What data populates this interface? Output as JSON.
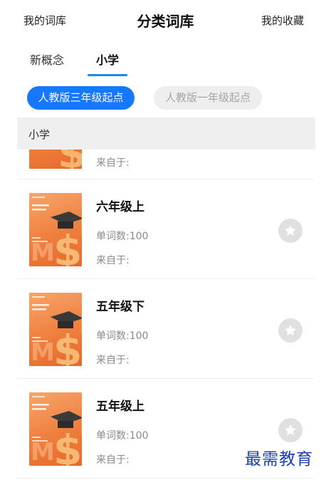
{
  "header": {
    "left_label": "我的词库",
    "title": "分类词库",
    "right_label": "我的收藏"
  },
  "tabs": [
    {
      "label": "新概念",
      "active": false
    },
    {
      "label": "小学",
      "active": true
    }
  ],
  "chips": [
    {
      "label": "人教版三年级起点",
      "active": true
    },
    {
      "label": "人教版一年级起点",
      "active": false
    }
  ],
  "section": {
    "label": "小学"
  },
  "partial_item": {
    "from_label": "来自于:"
  },
  "items": [
    {
      "name": "六年级上",
      "count_label": "单词数:100",
      "from_label": "来自于:",
      "favorited": false
    },
    {
      "name": "五年级下",
      "count_label": "单词数:100",
      "from_label": "来自于:",
      "favorited": false
    },
    {
      "name": "五年级上",
      "count_label": "单词数:100",
      "from_label": "来自于:",
      "favorited": false
    }
  ],
  "watermark": "最需教育",
  "colors": {
    "accent": "#1677ff",
    "tab_underline": "#1e88e5",
    "cover_orange": "#ef7f3e",
    "watermark": "#1a3fb5"
  }
}
